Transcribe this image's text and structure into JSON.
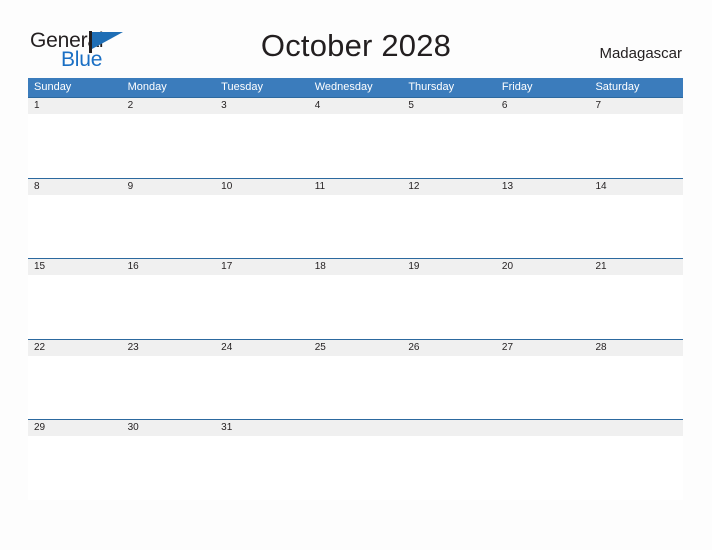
{
  "brand": {
    "name_line1": "General",
    "name_line2": "Blue",
    "flag_icon": "blue-flag-triangle-icon",
    "primary_color": "#1a6fc4",
    "dark_color": "#231f20"
  },
  "header": {
    "title": "October 2028",
    "country": "Madagascar"
  },
  "colors": {
    "header_blue": "#3b7cbc",
    "row_divider_blue": "#2c699f",
    "date_strip_gray": "#f0f0f0",
    "page_background": "#fdfdfd",
    "text_dark": "#231f20",
    "header_text": "#ffffff"
  },
  "calendar": {
    "month": "October",
    "year": "2028",
    "weekdays": [
      "Sunday",
      "Monday",
      "Tuesday",
      "Wednesday",
      "Thursday",
      "Friday",
      "Saturday"
    ],
    "weeks": [
      [
        "1",
        "2",
        "3",
        "4",
        "5",
        "6",
        "7"
      ],
      [
        "8",
        "9",
        "10",
        "11",
        "12",
        "13",
        "14"
      ],
      [
        "15",
        "16",
        "17",
        "18",
        "19",
        "20",
        "21"
      ],
      [
        "22",
        "23",
        "24",
        "25",
        "26",
        "27",
        "28"
      ],
      [
        "29",
        "30",
        "31",
        "",
        "",
        "",
        ""
      ]
    ]
  }
}
